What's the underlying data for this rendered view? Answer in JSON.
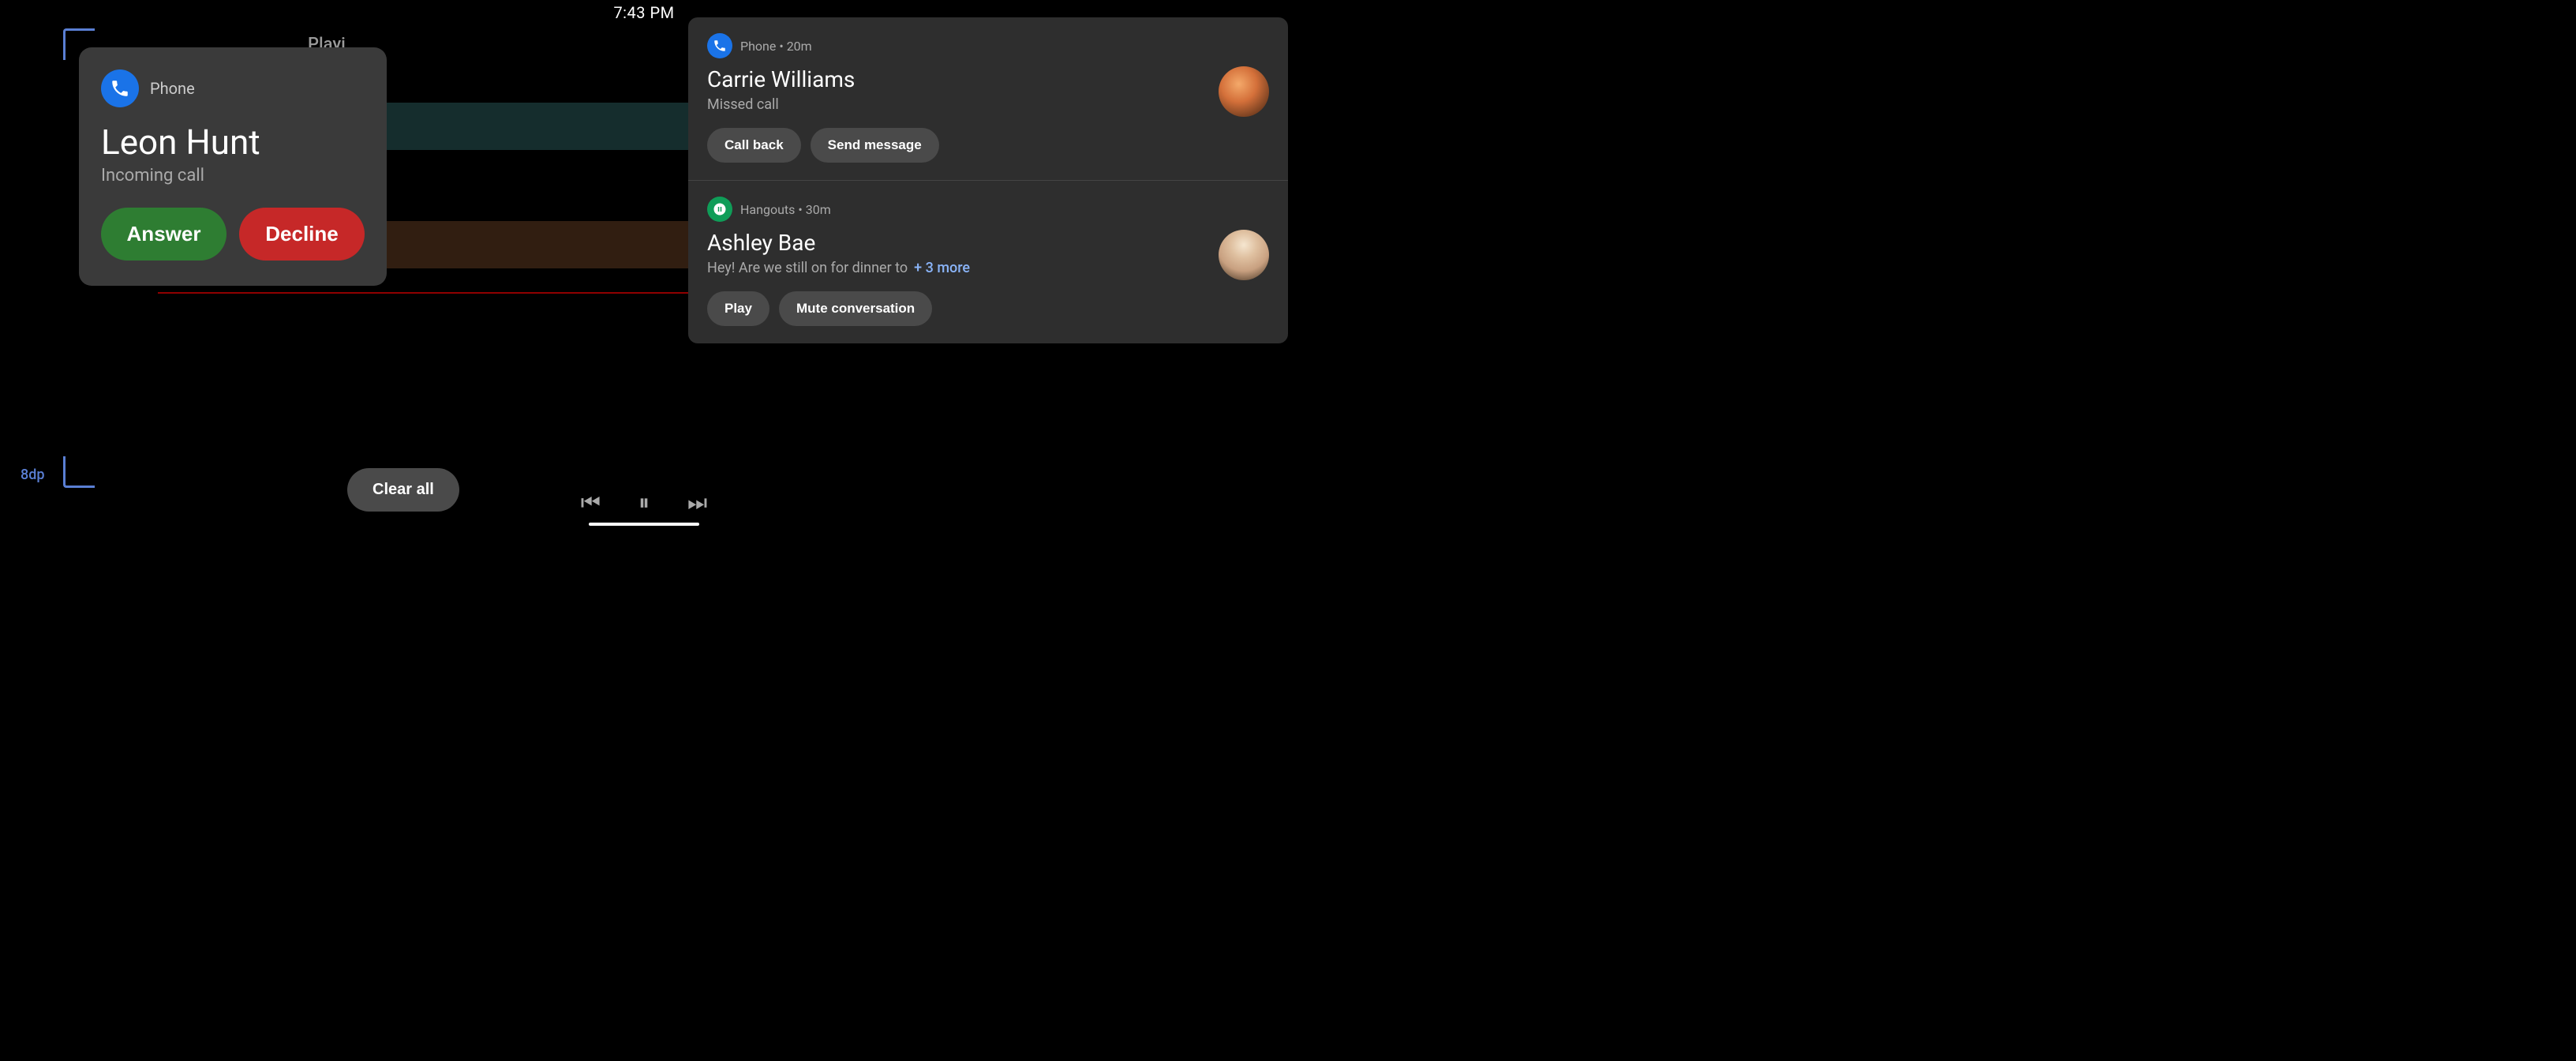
{
  "statusBar": {
    "time": "7:43 PM"
  },
  "bgText": "Playi",
  "bracketLabel": "8dp",
  "callCard": {
    "appName": "Phone",
    "callerName": "Leon Hunt",
    "subtitle": "Incoming call",
    "answerLabel": "Answer",
    "declineLabel": "Decline"
  },
  "notifications": [
    {
      "appName": "Phone",
      "timeAgo": "20m",
      "contactName": "Carrie Williams",
      "message": "Missed call",
      "moreText": "",
      "actions": [
        "Call back",
        "Send message"
      ],
      "appType": "phone"
    },
    {
      "appName": "Hangouts",
      "timeAgo": "30m",
      "contactName": "Ashley Bae",
      "message": "Hey! Are we still on for dinner to",
      "moreText": "+ 3 more",
      "actions": [
        "Play",
        "Mute conversation"
      ],
      "appType": "hangouts"
    }
  ],
  "clearAllLabel": "Clear all",
  "mediaControls": {
    "prevIcon": "⏮",
    "pauseIcon": "⏸",
    "nextIcon": "⏭"
  }
}
